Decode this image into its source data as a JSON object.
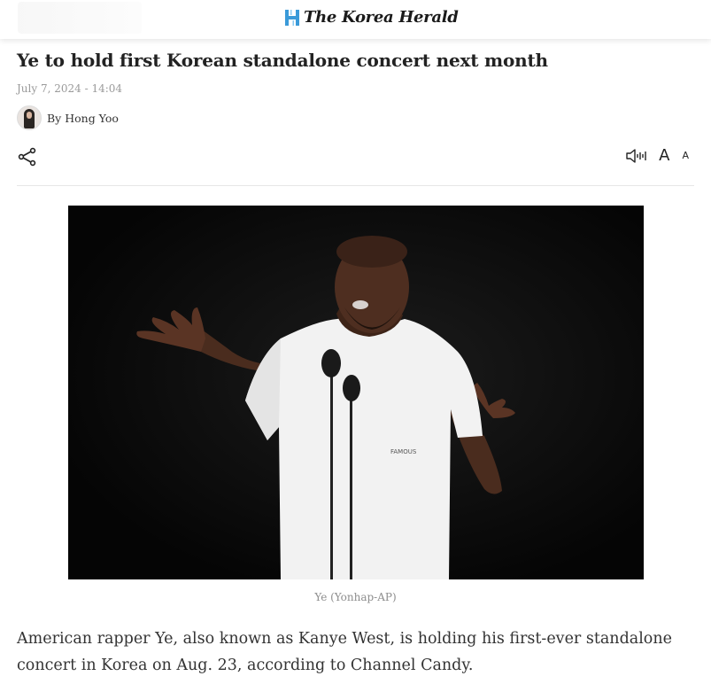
{
  "brand": {
    "name": "The Korea Herald"
  },
  "article": {
    "headline": "Ye to hold first Korean standalone concert next month",
    "date": "July 7, 2024 - 14:04",
    "byline": "By Hong Yoo",
    "photo_shirt_text": "FAMOUS",
    "caption": "Ye (Yonhap-AP)",
    "body": "American rapper Ye, also known as Kanye West, is holding his first-ever standalone concert in Korea on Aug. 23, according to Channel Candy."
  },
  "toolbar": {
    "share_icon": "share-icon",
    "tts_icon": "speaker-icon",
    "font_large_label": "A",
    "font_small_label": "A"
  }
}
